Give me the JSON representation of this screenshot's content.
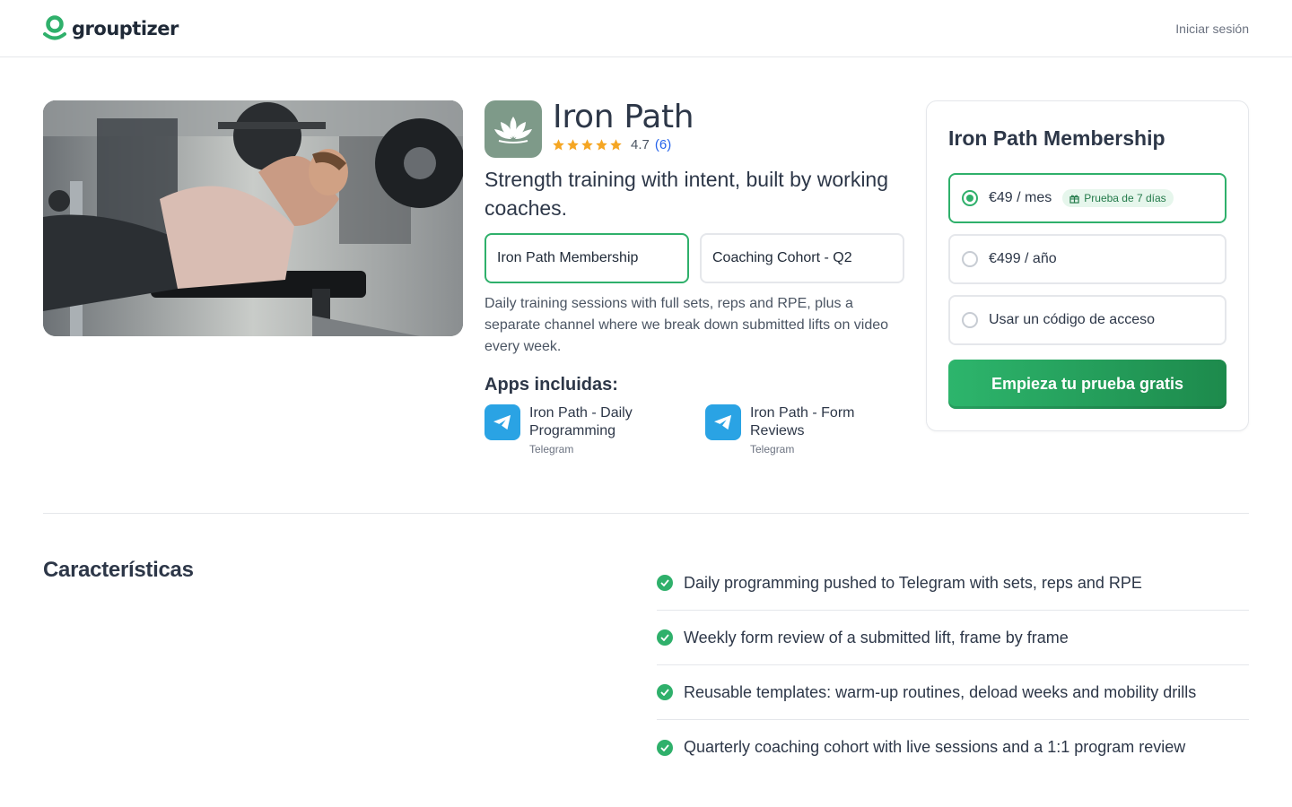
{
  "header": {
    "brand": "grouptizer",
    "login_label": "Iniciar sesión"
  },
  "product": {
    "title": "Iron Path",
    "rating_value": "4.7",
    "rating_count": "(6)",
    "rating_stars": 5,
    "tagline": "Strength training with intent, built by working coaches.",
    "plans": [
      "Iron Path Membership",
      "Coaching Cohort - Q2"
    ],
    "active_plan": 0,
    "description": "Daily training sessions with full sets, reps and RPE, plus a separate channel where we break down submitted lifts on video every week.",
    "apps_heading": "Apps incluidas:",
    "apps": [
      {
        "name": "Iron Path - Daily Programming",
        "platform": "Telegram",
        "icon": "telegram-icon"
      },
      {
        "name": "Iron Path - Form Reviews",
        "platform": "Telegram",
        "icon": "telegram-icon"
      }
    ]
  },
  "pricing": {
    "title": "Iron Path Membership",
    "options": [
      {
        "label": "€49 / mes",
        "badge": "Prueba de 7 días",
        "selected": true
      },
      {
        "label": "€499 / año",
        "selected": false
      },
      {
        "label": "Usar un código de acceso",
        "selected": false
      }
    ],
    "cta_label": "Empieza tu prueba gratis"
  },
  "features": {
    "title": "Características",
    "items": [
      "Daily programming pushed to Telegram with sets, reps and RPE",
      "Weekly form review of a submitted lift, frame by frame",
      "Reusable templates: warm-up routines, deload weeks and mobility drills",
      "Quarterly coaching cohort with live sessions and a 1:1 program review"
    ]
  },
  "colors": {
    "accent": "#2fb06b",
    "star": "#f5a623",
    "link": "#2563eb",
    "app_icon_bg": "#7e9a89",
    "telegram": "#2aa3e4"
  }
}
